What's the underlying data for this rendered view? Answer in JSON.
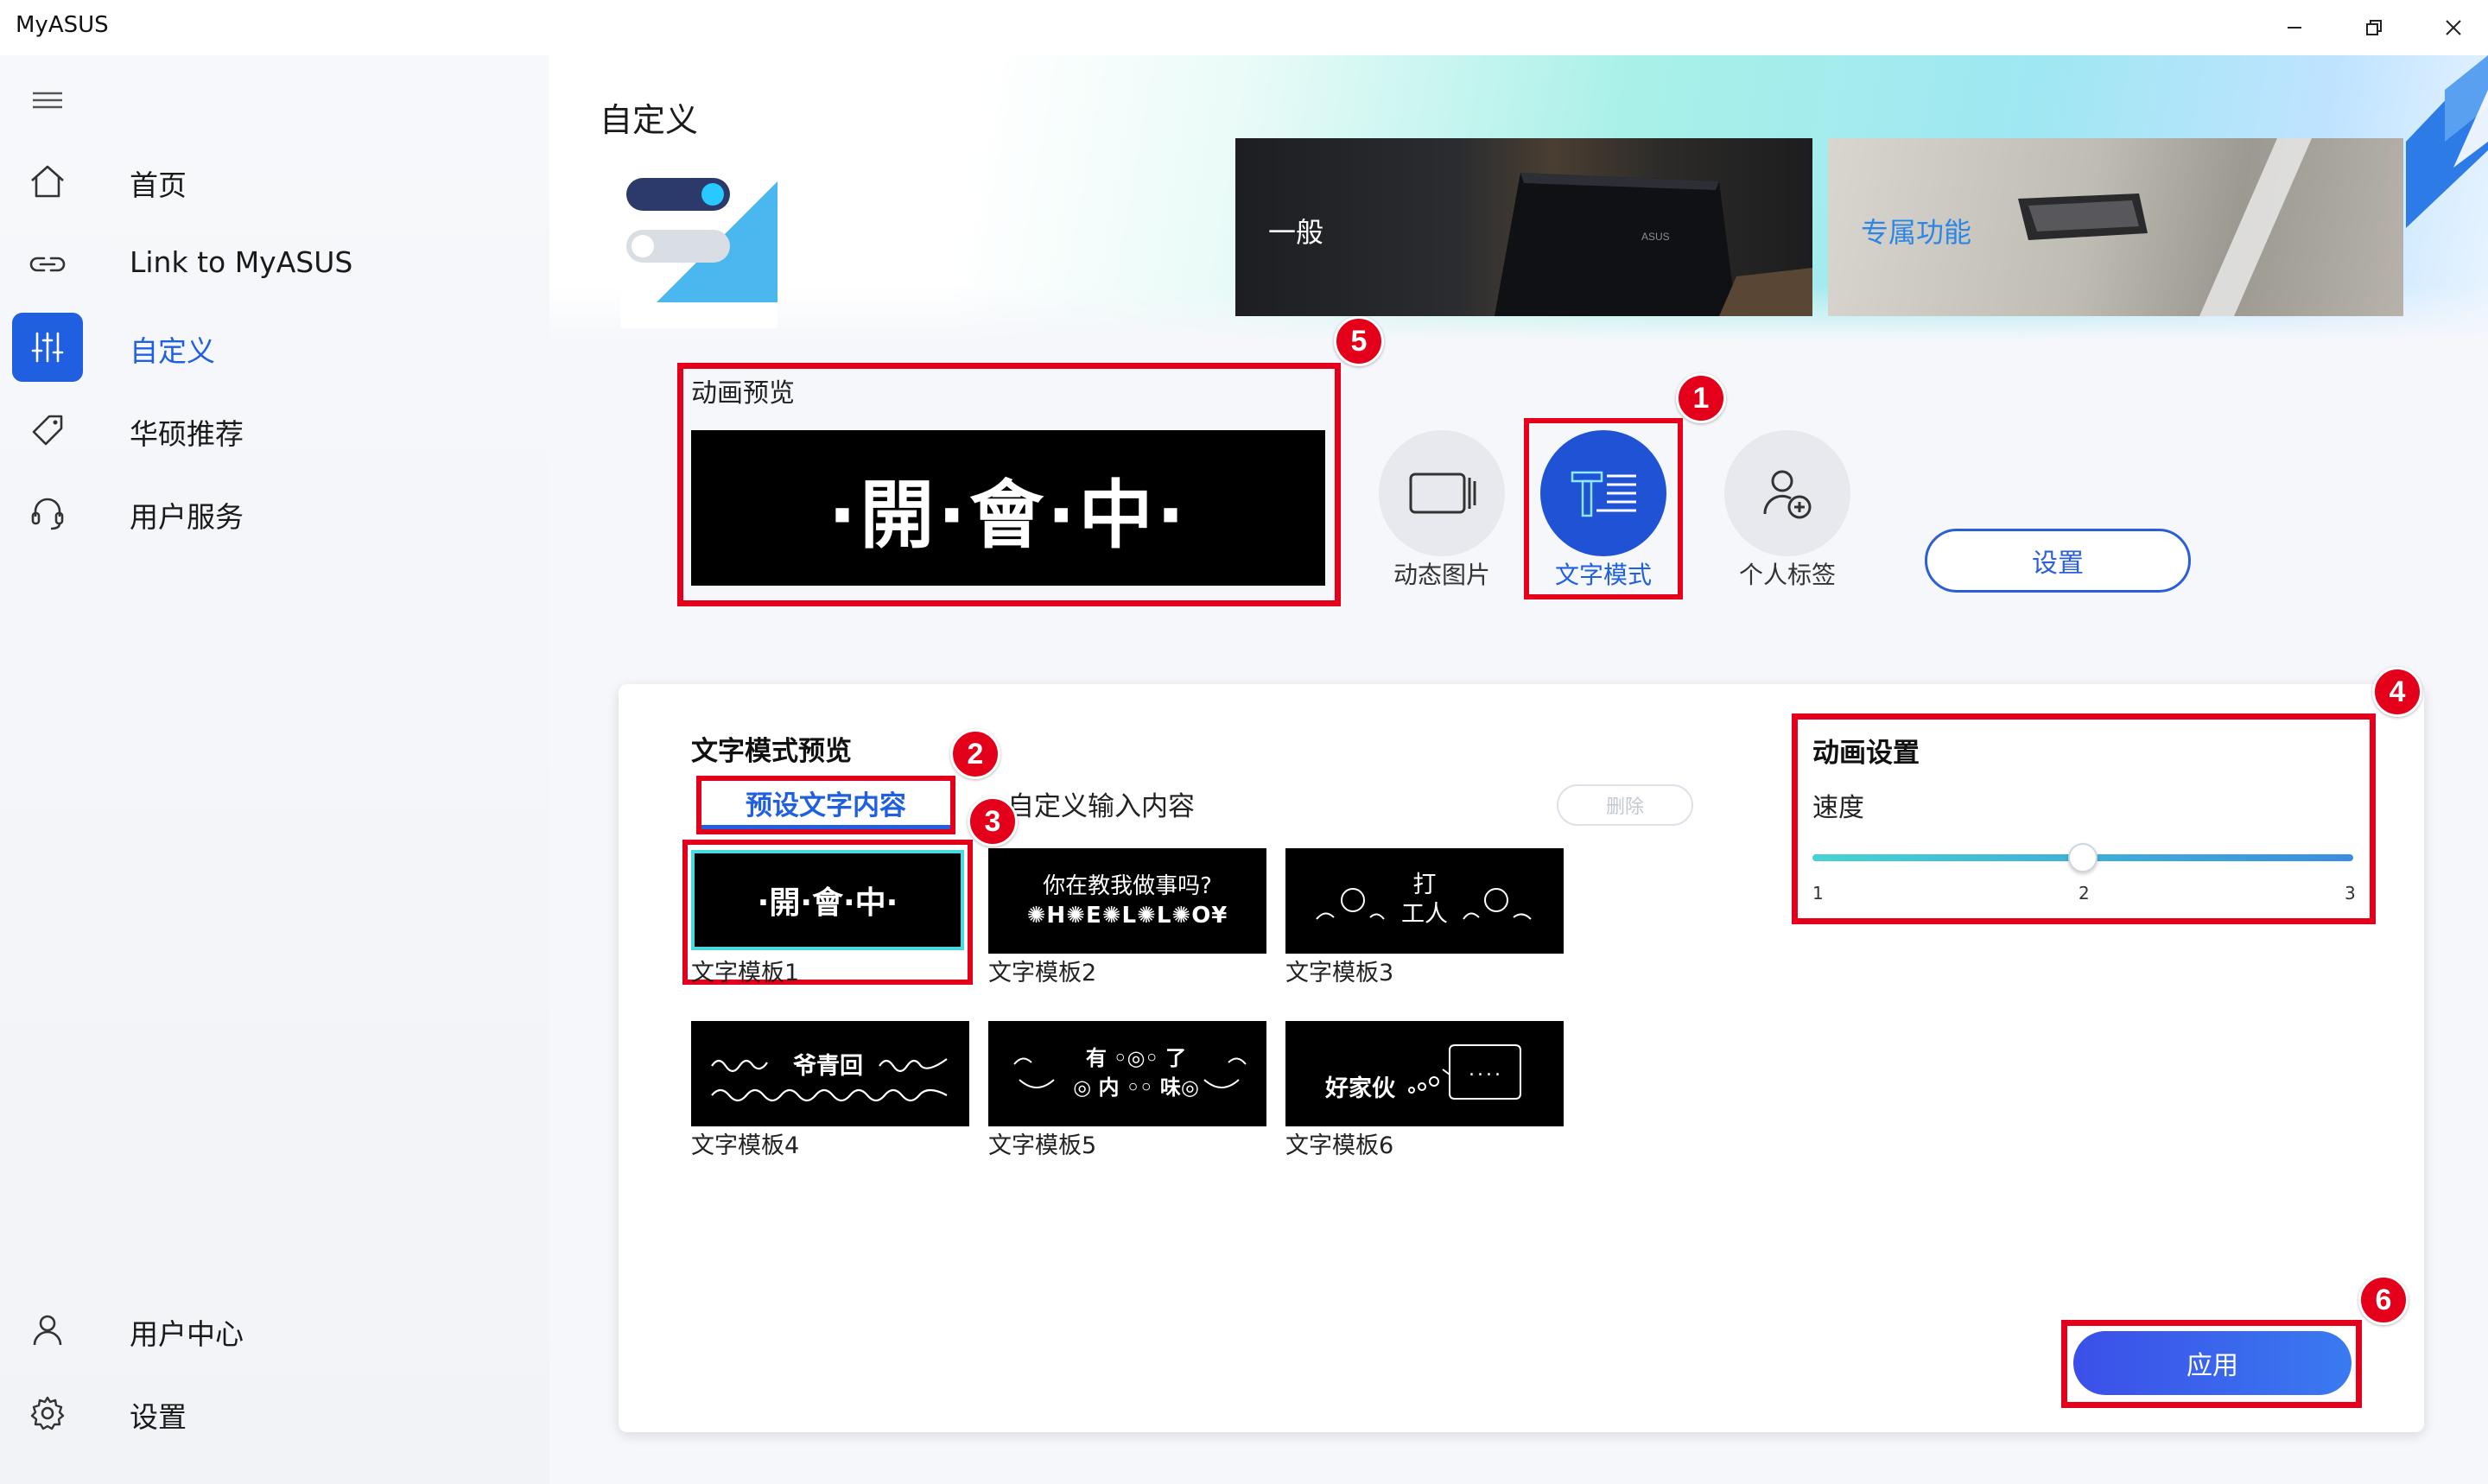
{
  "window": {
    "title": "MyASUS",
    "minimize_icon": "minimize-icon",
    "restore_icon": "restore-icon",
    "close_icon": "close-icon"
  },
  "sidebar": {
    "menu_icon": "hamburger-menu-icon",
    "items": [
      {
        "label": "首页",
        "icon": "home-icon"
      },
      {
        "label": "Link to MyASUS",
        "icon": "link-icon"
      },
      {
        "label": "自定义",
        "icon": "sliders-icon",
        "active": true
      },
      {
        "label": "华硕推荐",
        "icon": "tag-icon"
      },
      {
        "label": "用户服务",
        "icon": "headset-icon"
      }
    ],
    "bottom_items": [
      {
        "label": "用户中心",
        "icon": "user-icon"
      },
      {
        "label": "设置",
        "icon": "gear-icon"
      }
    ]
  },
  "header": {
    "page_title": "自定义",
    "banners": [
      {
        "label": "一般"
      },
      {
        "label": "专属功能"
      }
    ]
  },
  "preview": {
    "title": "动画预览",
    "text": "·開·會·中·"
  },
  "modes": [
    {
      "label": "动态图片",
      "icon": "animated-image-icon"
    },
    {
      "label": "文字模式",
      "icon": "text-mode-icon",
      "selected": true
    },
    {
      "label": "个人标签",
      "icon": "personal-tag-icon"
    }
  ],
  "settings_button": "设置",
  "text_mode": {
    "title": "文字模式预览",
    "tabs": {
      "preset": "预设文字内容",
      "custom": "自定义输入内容"
    },
    "delete_label": "删除",
    "templates": [
      {
        "label": "文字模板1",
        "content": "·開·會·中·",
        "selected": true
      },
      {
        "label": "文字模板2",
        "content_line1": "你在教我做事吗?",
        "content_line2": "✺H✺E✺L✺L✺O¥"
      },
      {
        "label": "文字模板3",
        "content_line1": "打",
        "content_line2": "工人"
      },
      {
        "label": "文字模板4",
        "content": "爷青回"
      },
      {
        "label": "文字模板5",
        "content_line1": "有 ◦◎◦ 了",
        "content_line2": "◎ 内 ◦◦ 味◎"
      },
      {
        "label": "文字模板6",
        "content": "好家伙",
        "bubble": "...."
      }
    ]
  },
  "animation_settings": {
    "title": "动画设置",
    "speed_label": "速度",
    "speed_value": 2,
    "speed_min": 1,
    "speed_max": 3,
    "ticks": [
      "1",
      "2",
      "3"
    ]
  },
  "apply_button": "应用",
  "callouts": [
    "1",
    "2",
    "3",
    "4",
    "5",
    "6"
  ],
  "colors": {
    "accent": "#1f5fe0",
    "highlight_red": "#e4001a",
    "apply_gradient_start": "#3b4fe8",
    "apply_gradient_end": "#3a7af0"
  }
}
